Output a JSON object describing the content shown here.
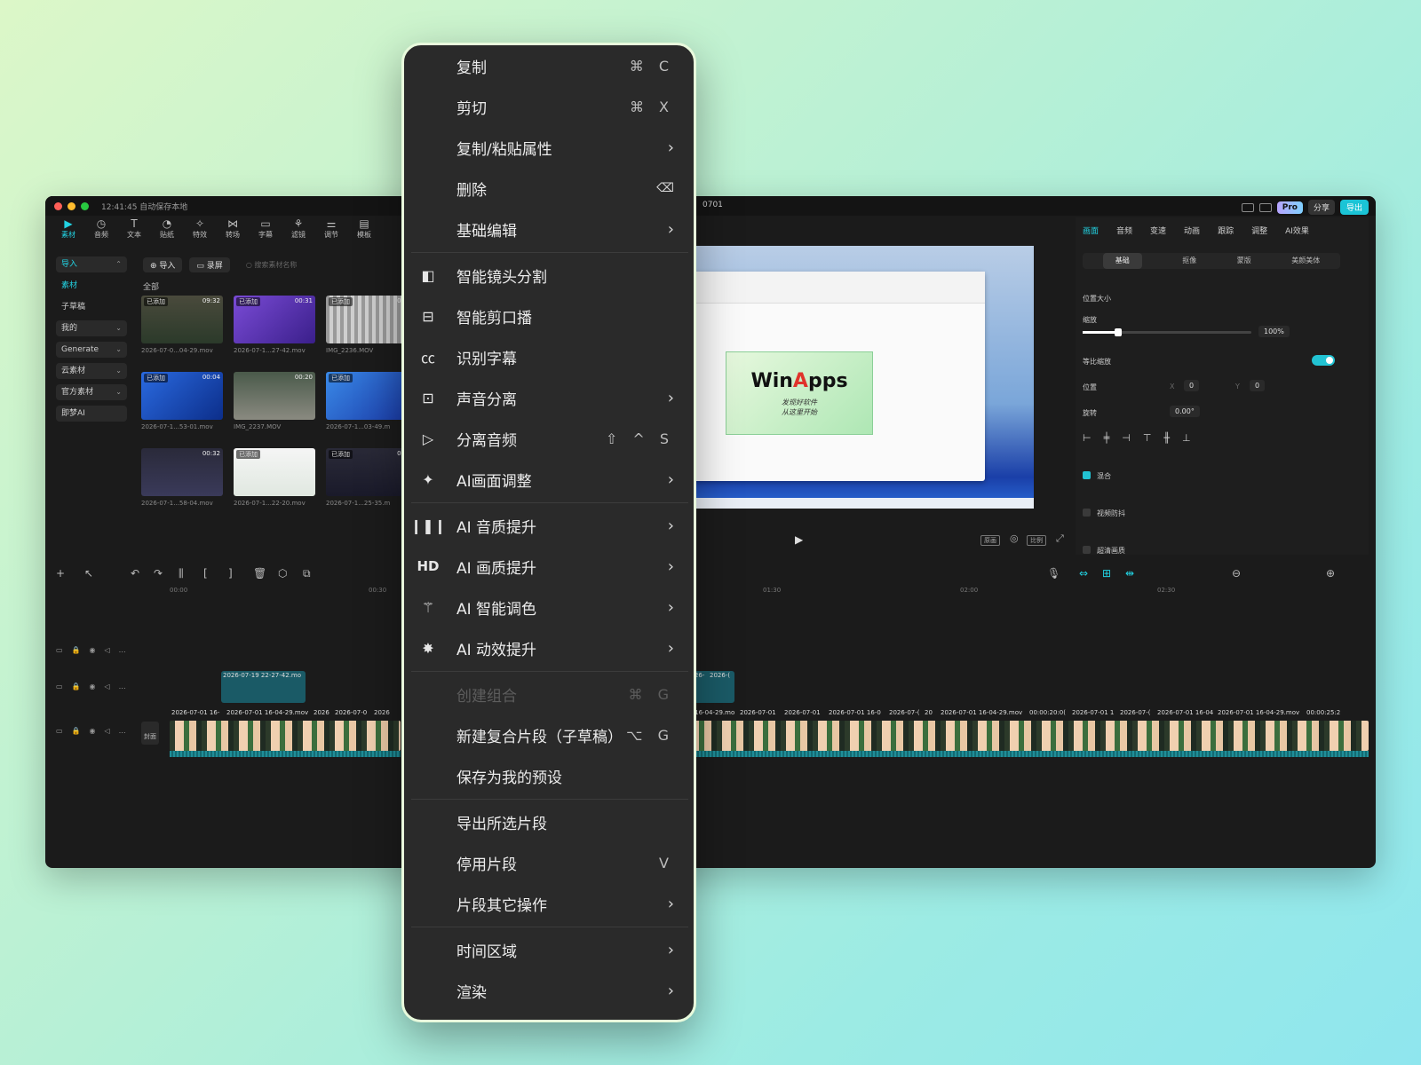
{
  "window": {
    "title": "12:41:45 自动保存本地",
    "project_name": "0701",
    "pro_label": "Pro",
    "share_label": "分享",
    "export_label": "导出"
  },
  "toolbar": [
    {
      "label": "素材",
      "icon": "media-icon",
      "active": true
    },
    {
      "label": "音频",
      "icon": "audio-icon"
    },
    {
      "label": "文本",
      "icon": "text-icon"
    },
    {
      "label": "贴纸",
      "icon": "sticker-icon"
    },
    {
      "label": "特效",
      "icon": "effects-icon"
    },
    {
      "label": "转场",
      "icon": "transition-icon"
    },
    {
      "label": "字幕",
      "icon": "caption-icon"
    },
    {
      "label": "滤镜",
      "icon": "filter-icon"
    },
    {
      "label": "调节",
      "icon": "adjust-icon"
    },
    {
      "label": "模板",
      "icon": "template-icon"
    }
  ],
  "left_nav": {
    "import": "导入",
    "media": "素材",
    "drafts": "子草稿",
    "mine": "我的",
    "generate": "Generate",
    "cloud": "云素材",
    "official": "官方素材",
    "dream": "即梦AI"
  },
  "media_panel": {
    "import_btn": "导入",
    "record_btn": "录屏",
    "search_placeholder": "搜索素材名称",
    "all_label": "全部",
    "thumbs": [
      {
        "badge": "已添加",
        "duration": "09:32",
        "caption": "2026-07-0...04-29.mov"
      },
      {
        "badge": "已添加",
        "duration": "00:31",
        "caption": "2026-07-1...27-42.mov"
      },
      {
        "badge": "已添加",
        "duration": "00",
        "caption": "IMG_2236.MOV"
      },
      {
        "badge": "已添加",
        "duration": "00:04",
        "caption": "2026-07-1...53-01.mov"
      },
      {
        "badge": "",
        "duration": "00:20",
        "caption": "IMG_2237.MOV"
      },
      {
        "badge": "已添加",
        "duration": "",
        "caption": "2026-07-1...03-49.m"
      },
      {
        "badge": "",
        "duration": "00:32",
        "caption": "2026-07-1...58-04.mov"
      },
      {
        "badge": "已添加",
        "duration": "",
        "caption": "2026-07-1...22-20.mov"
      },
      {
        "badge": "已添加",
        "duration": "00",
        "caption": "2026-07-1...25-35.m"
      }
    ]
  },
  "preview": {
    "logo_main": "WinApps",
    "tagline_1": "发现好软件",
    "tagline_2": "从这里开始",
    "btn_original": "原画",
    "btn_ratio": "比例"
  },
  "inspector": {
    "tabs": [
      "画面",
      "音频",
      "变速",
      "动画",
      "跟踪",
      "调整",
      "AI效果"
    ],
    "subtabs": [
      "基础",
      "抠像",
      "蒙版",
      "美颜美体"
    ],
    "pos_size": "位置大小",
    "scale_label": "缩放",
    "scale_value": "100%",
    "uniform_scale": "等比缩放",
    "position_label": "位置",
    "x_label": "X",
    "x_value": "0",
    "y_label": "Y",
    "y_value": "0",
    "rotate_label": "旋转",
    "rotate_value": "0.00°",
    "blend_label": "混合",
    "stabilize_label": "视频防抖",
    "hd_label": "超清画质"
  },
  "timeline": {
    "ruler": [
      "00:00",
      "00:30",
      "01:30",
      "02:00",
      "02:30"
    ],
    "cover_label": "封面",
    "clip_top_label": "2026-07-19 22-27-42.mo",
    "clip_labels": [
      "2026-07-01 16-",
      "2026-07-01 16-04-29.mov",
      "2026",
      "2026-07-0",
      "2026"
    ],
    "clip_labels_right": [
      "01 16-04-29.mo",
      "2026-07-01",
      "2026-07-01",
      "2026-07-01 16-0",
      "2026-07-(",
      "20",
      "2026-07-01 16-04-29.mov",
      "00:00:20:0(",
      "2026-07-01 1",
      "2026-07-(",
      "2026-07-01 16-04",
      "2026-07-01 16-04-29.mov",
      "00:00:25:2"
    ],
    "mid_clip_labels": [
      "2026-",
      "2026-("
    ]
  },
  "context_menu": {
    "items": [
      {
        "label": "复制",
        "shortcut": "⌘ C"
      },
      {
        "label": "剪切",
        "shortcut": "⌘ X"
      },
      {
        "label": "复制/粘贴属性",
        "submenu": true
      },
      {
        "label": "删除",
        "shortcut_icon": "delete-key-icon"
      },
      {
        "label": "基础编辑",
        "submenu": true
      },
      {
        "label": "智能镜头分割",
        "icon": "scene-split-icon"
      },
      {
        "label": "智能剪口播",
        "icon": "smart-cut-icon"
      },
      {
        "label": "识别字幕",
        "icon": "caption-recognize-icon"
      },
      {
        "label": "声音分离",
        "icon": "voice-separate-icon",
        "submenu": true
      },
      {
        "label": "分离音频",
        "icon": "detach-audio-icon",
        "shortcut": "⇧ ^ S"
      },
      {
        "label": "AI画面调整",
        "icon": "ai-frame-adjust-icon",
        "submenu": true
      },
      {
        "label": "AI 音质提升",
        "icon": "ai-audio-enhance-icon",
        "submenu": true
      },
      {
        "label": "AI 画质提升",
        "icon": "hd-icon",
        "submenu": true
      },
      {
        "label": "AI 智能调色",
        "icon": "magic-wand-icon",
        "submenu": true
      },
      {
        "label": "AI 动效提升",
        "icon": "motion-icon",
        "submenu": true
      },
      {
        "label": "创建组合",
        "shortcut": "⌘ G",
        "disabled": true
      },
      {
        "label": "新建复合片段（子草稿）",
        "shortcut": "⌥ G"
      },
      {
        "label": "保存为我的预设"
      },
      {
        "label": "导出所选片段"
      },
      {
        "label": "停用片段",
        "shortcut": "V"
      },
      {
        "label": "片段其它操作",
        "submenu": true
      },
      {
        "label": "时间区域",
        "submenu": true
      },
      {
        "label": "渲染",
        "submenu": true
      }
    ],
    "hd_text": "HD"
  }
}
